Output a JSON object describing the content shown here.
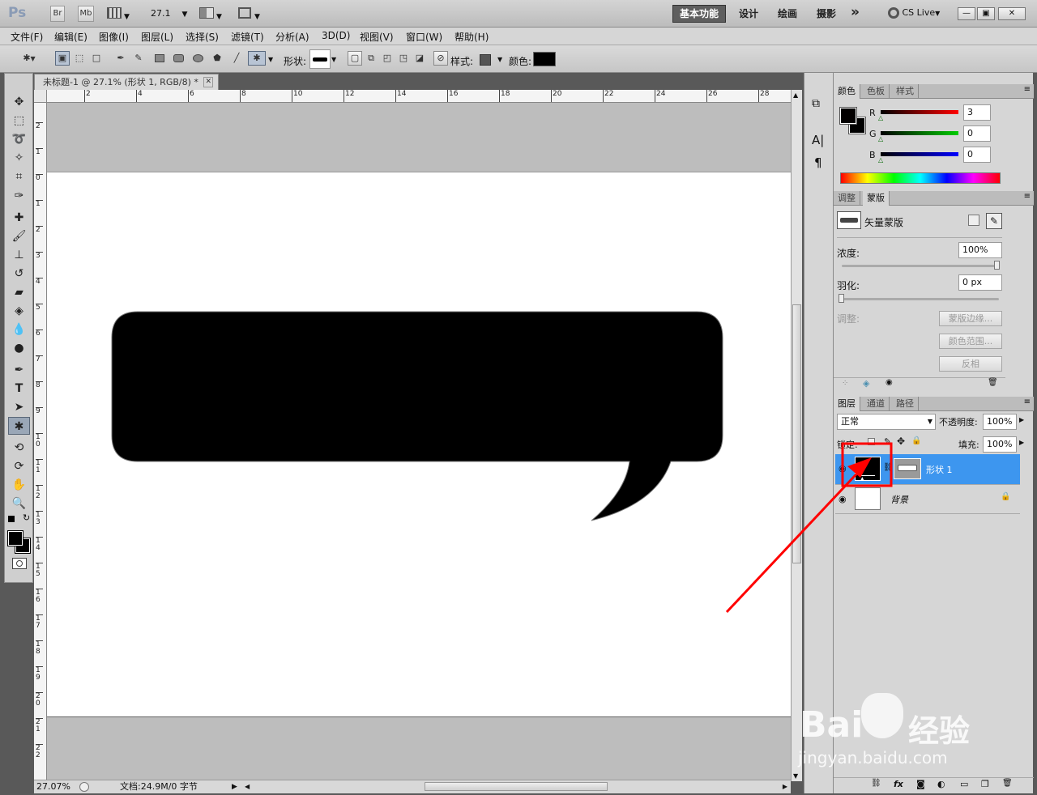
{
  "appbar": {
    "logo": "Ps",
    "btn_br": "Br",
    "btn_mb": "Mb",
    "zoom": "27.1",
    "workspaces": [
      "基本功能",
      "设计",
      "绘画",
      "摄影"
    ],
    "more": "»",
    "cslive": "CS Live",
    "window_buttons": [
      "—",
      "▣",
      "✕"
    ]
  },
  "menubar": {
    "items": [
      "文件(F)",
      "编辑(E)",
      "图像(I)",
      "图层(L)",
      "选择(S)",
      "滤镜(T)",
      "分析(A)",
      "3D(D)",
      "视图(V)",
      "窗口(W)",
      "帮助(H)"
    ]
  },
  "options": {
    "shape_label": "形状:",
    "style_label": "样式:",
    "color_label": "颜色:",
    "color_value": "#000000"
  },
  "document": {
    "tab_title": "未标题-1 @ 27.1% (形状 1, RGB/8) *",
    "close": "✕",
    "ruler_h_labels": [
      "2",
      "4",
      "6",
      "8",
      "10",
      "12",
      "14",
      "16",
      "18",
      "20",
      "22",
      "24",
      "26",
      "28"
    ],
    "ruler_v_labels": [
      "2",
      "1",
      "0",
      "1",
      "2",
      "3",
      "4",
      "5",
      "6",
      "7",
      "8",
      "9",
      "10",
      "11",
      "12",
      "13",
      "14",
      "15",
      "16",
      "17",
      "18",
      "19",
      "20",
      "21",
      "22"
    ]
  },
  "status": {
    "zoom": "27.07%",
    "doc": "文档:24.9M/0 字节"
  },
  "color_panel": {
    "tabs": [
      "颜色",
      "色板",
      "样式"
    ],
    "r_label": "R",
    "g_label": "G",
    "b_label": "B",
    "r": "3",
    "g": "0",
    "b": "0",
    "fg": "#030000",
    "bg": "#000000"
  },
  "mask_panel": {
    "tabs": [
      "调整",
      "蒙版"
    ],
    "title": "矢量蒙版",
    "density_label": "浓度:",
    "density": "100%",
    "feather_label": "羽化:",
    "feather": "0 px",
    "adjust_label": "调整:",
    "buttons": [
      "蒙版边缘...",
      "颜色范围...",
      "反相"
    ]
  },
  "layers_panel": {
    "tabs": [
      "图层",
      "通道",
      "路径"
    ],
    "blend": "正常",
    "opacity_label": "不透明度:",
    "opacity": "100%",
    "lock_label": "锁定:",
    "fill_label": "填充:",
    "fill": "100%",
    "layers": [
      {
        "name": "形状 1",
        "selected": true
      },
      {
        "name": "背景",
        "selected": false
      }
    ],
    "footer_icons": [
      "link-icon",
      "fx-icon",
      "mask-icon",
      "adjustment-icon",
      "folder-icon",
      "new-layer-icon",
      "trash-icon"
    ]
  },
  "mid_panel": {
    "char_icon": "A|",
    "para_icon": "¶"
  },
  "watermark": {
    "brand": "Bai",
    "brand2": "du",
    "cn": "经验",
    "url": "jingyan.baidu.com"
  },
  "annotation_color": "#ff0000"
}
